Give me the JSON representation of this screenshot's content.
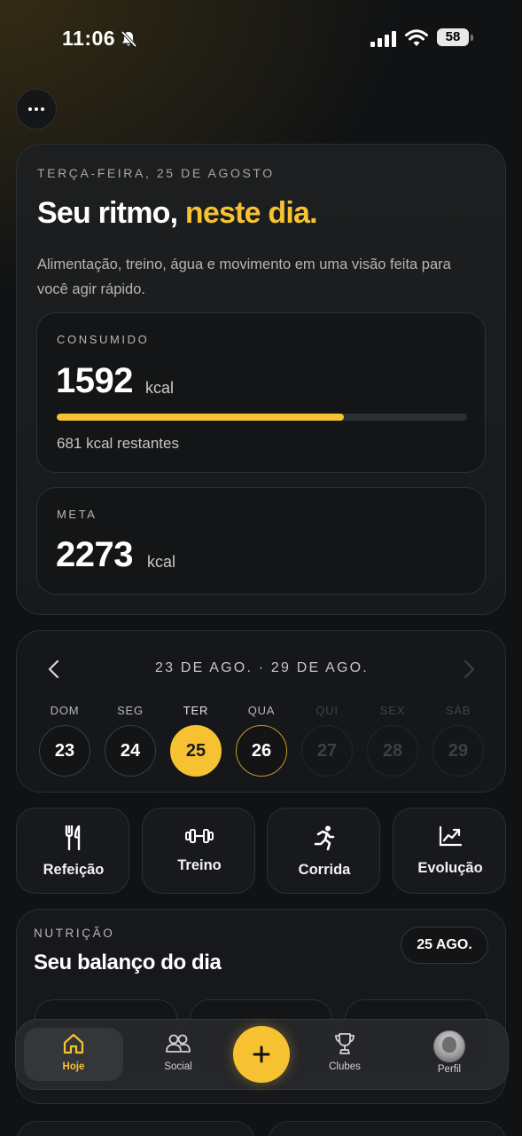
{
  "status_bar": {
    "time": "11:06",
    "battery": "58",
    "icons": [
      "bell-slash-icon",
      "signal-icon",
      "wifi-icon",
      "battery-icon"
    ]
  },
  "colors": {
    "accent": "#f6c232",
    "background": "#101214",
    "card": "#16181b"
  },
  "hero": {
    "date": "TERÇA-FEIRA, 25 DE AGOSTO",
    "headline_main": "Seu ritmo,",
    "headline_accent": "neste dia.",
    "subtitle": "Alimentação, treino, água e movimento em uma visão feita para você agir rápido.",
    "consumed": {
      "label": "CONSUMIDO",
      "value": "1592",
      "unit": "kcal",
      "progress_fraction": 0.7,
      "remaining": "681 kcal restantes"
    },
    "goal": {
      "label": "META",
      "value": "2273",
      "unit": "kcal"
    }
  },
  "week": {
    "range": "23 DE AGO. · 29 DE AGO.",
    "days": [
      {
        "name": "DOM",
        "num": "23",
        "state": "normal"
      },
      {
        "name": "SEG",
        "num": "24",
        "state": "normal"
      },
      {
        "name": "TER",
        "num": "25",
        "state": "selected"
      },
      {
        "name": "QUA",
        "num": "26",
        "state": "today"
      },
      {
        "name": "QUI",
        "num": "27",
        "state": "disabled"
      },
      {
        "name": "SEX",
        "num": "28",
        "state": "disabled"
      },
      {
        "name": "SÁB",
        "num": "29",
        "state": "disabled"
      }
    ]
  },
  "actions": [
    {
      "label": "Refeição",
      "icon": "fork-knife-icon"
    },
    {
      "label": "Treino",
      "icon": "dumbbell-icon"
    },
    {
      "label": "Corrida",
      "icon": "running-icon"
    },
    {
      "label": "Evolução",
      "icon": "chart-line-icon"
    }
  ],
  "nutrition": {
    "label": "NUTRIÇÃO",
    "title": "Seu balanço do dia",
    "date_pill": "25 AGO."
  },
  "tabbar": {
    "tabs": [
      {
        "label": "Hoje",
        "icon": "home-icon",
        "active": true
      },
      {
        "label": "Social",
        "icon": "people-icon",
        "active": false
      },
      {
        "label": "Clubes",
        "icon": "trophy-icon",
        "active": false
      },
      {
        "label": "Perfil",
        "icon": "avatar",
        "active": false
      }
    ],
    "fab_icon": "plus-icon"
  }
}
